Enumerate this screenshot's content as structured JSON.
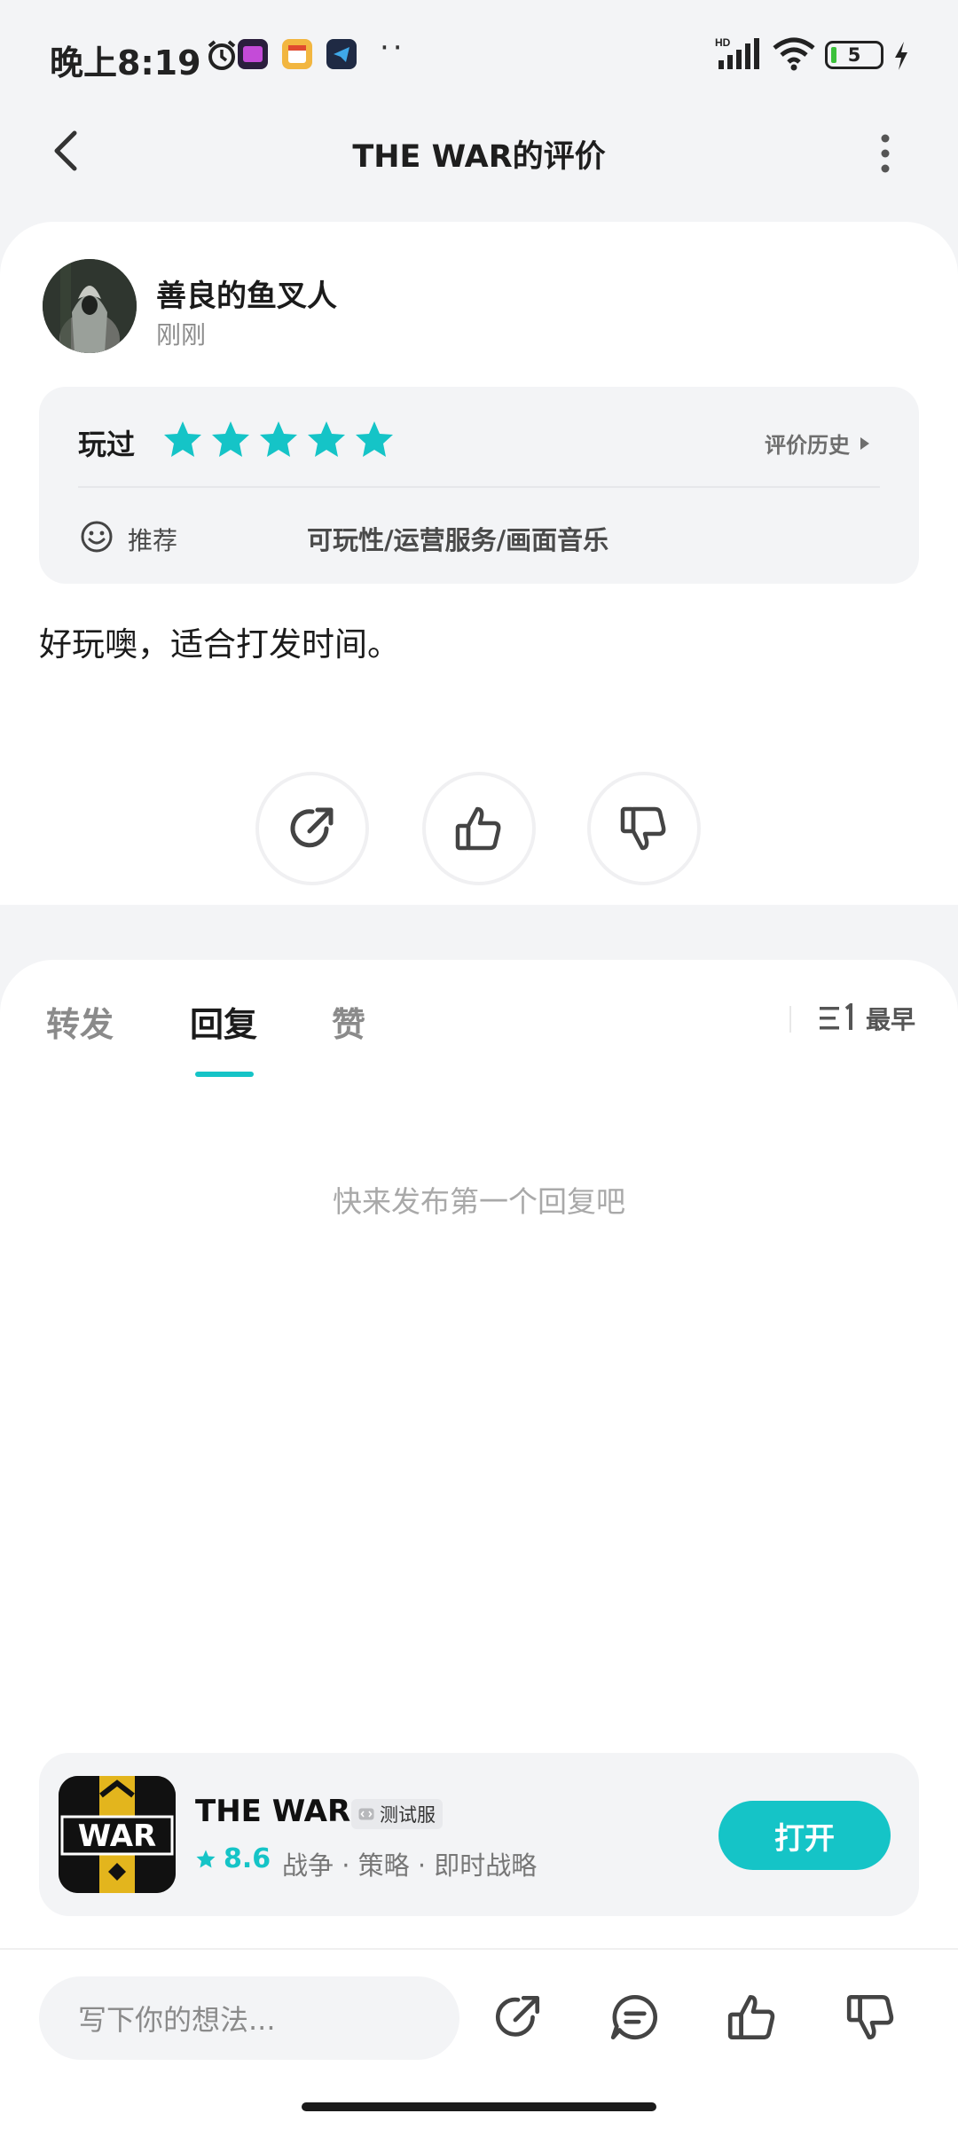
{
  "status_bar": {
    "time": "晚上8:19",
    "dots": "··",
    "battery": "5"
  },
  "header": {
    "title": "THE WAR的评价"
  },
  "review": {
    "username": "善良的鱼叉人",
    "time": "刚刚",
    "played_label": "玩过",
    "star_rating": 5,
    "history_label": "评价历史",
    "recommend_label": "推荐",
    "tags": "可玩性/运营服务/画面音乐",
    "content": "好玩噢，适合打发时间。"
  },
  "tabs": {
    "items": [
      "转发",
      "回复",
      "赞"
    ],
    "active": "回复",
    "sort_label": "最早",
    "empty_message": "快来发布第一个回复吧"
  },
  "app": {
    "name": "THE WAR",
    "badge": "测试服",
    "rating": "8.6",
    "tags": "战争 · 策略 · 即时战略",
    "open_label": "打开",
    "icon_text": "WAR"
  },
  "bottom_bar": {
    "placeholder": "写下你的想法..."
  },
  "colors": {
    "accent": "#15c4c7",
    "background": "#f3f4f6"
  }
}
